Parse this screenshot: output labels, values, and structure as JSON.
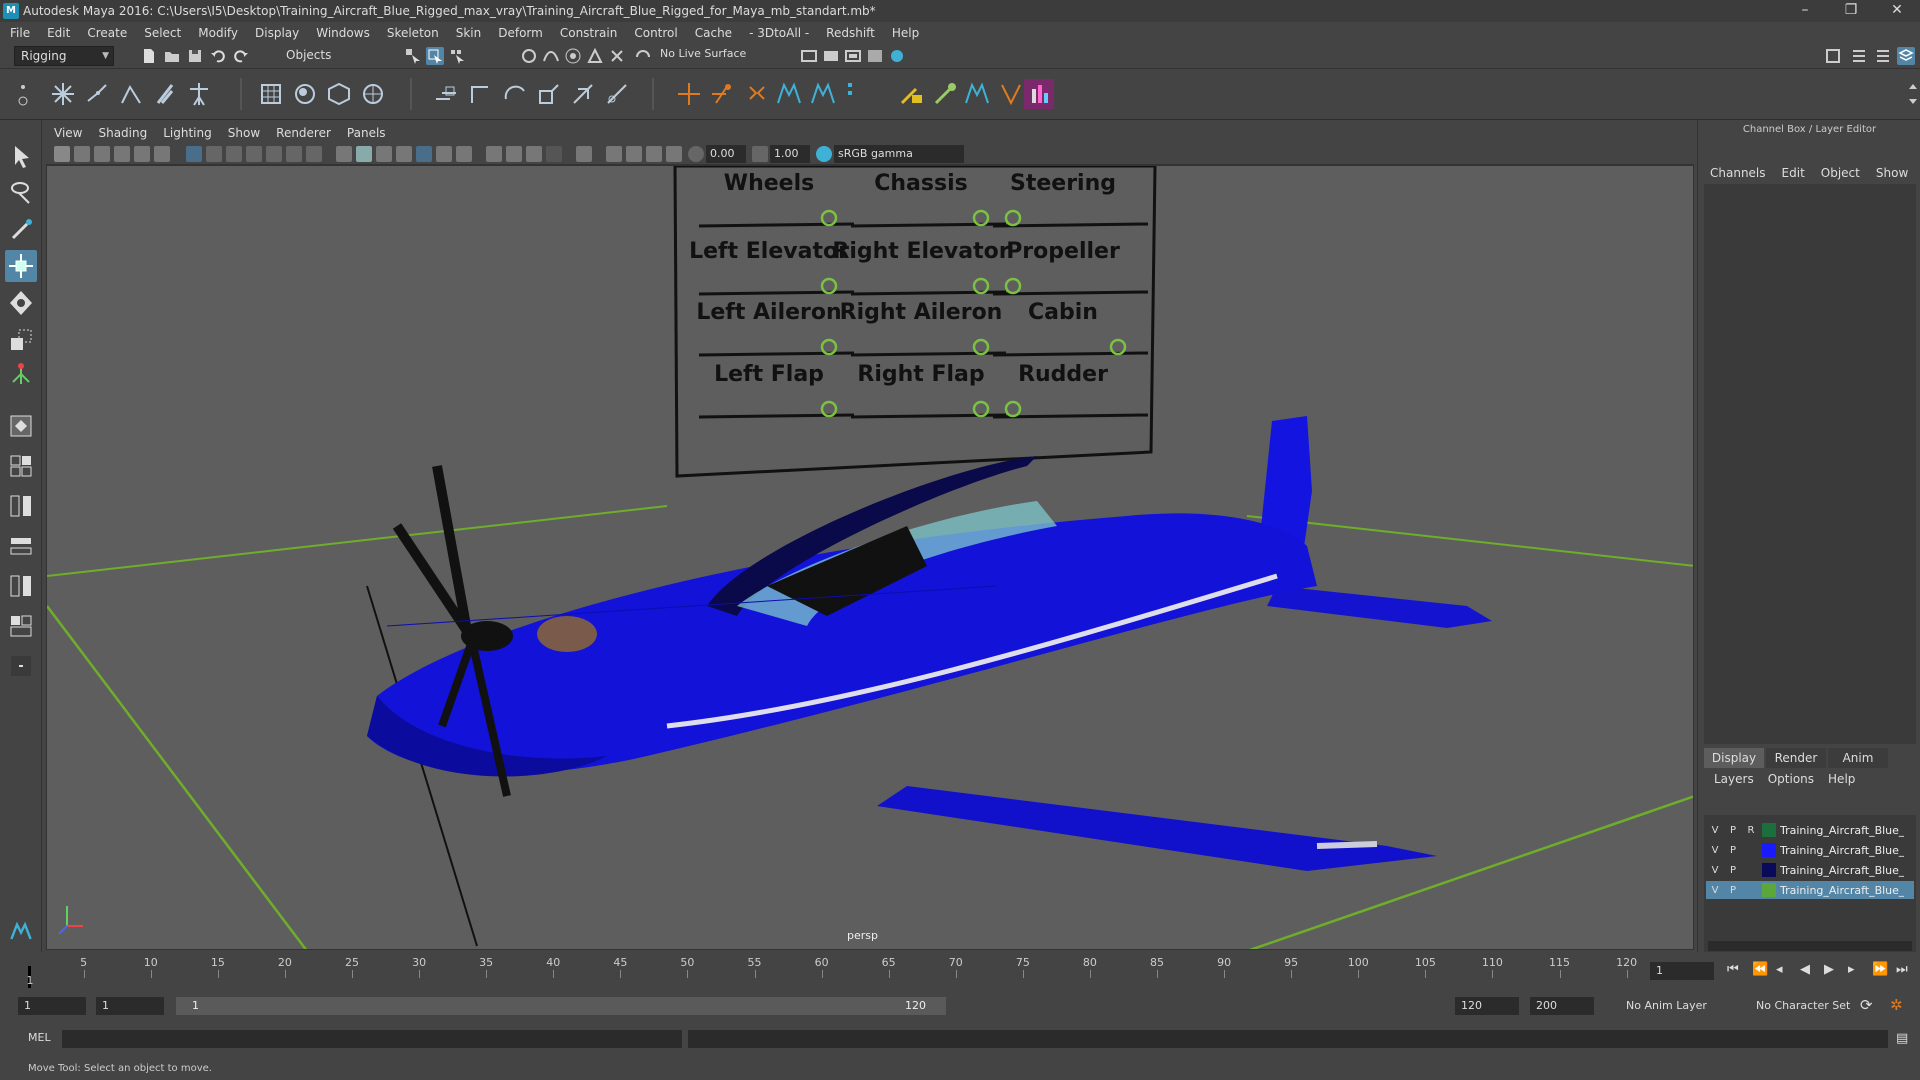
{
  "window": {
    "app_icon": "M",
    "title": "Autodesk Maya 2016: C:\\Users\\I5\\Desktop\\Training_Aircraft_Blue_Rigged_max_vray\\Training_Aircraft_Blue_Rigged_for_Maya_mb_standart.mb*",
    "controls": [
      "–",
      "❐",
      "✕"
    ]
  },
  "menubar": [
    "File",
    "Edit",
    "Create",
    "Select",
    "Modify",
    "Display",
    "Windows",
    "Skeleton",
    "Skin",
    "Deform",
    "Constrain",
    "Control",
    "Cache",
    "- 3DtoAll -",
    "Redshift",
    "Help"
  ],
  "status_line": {
    "menu_set": "Rigging",
    "selection_mode": "Objects",
    "live_surface": "No Live Surface"
  },
  "viewport": {
    "menu": [
      "View",
      "Shading",
      "Lighting",
      "Show",
      "Renderer",
      "Panels"
    ],
    "exposure": "0.00",
    "gamma": "1.00",
    "color_space": "sRGB gamma",
    "camera": "persp",
    "control_board": {
      "labels": [
        "Wheels",
        "Chassis",
        "Steering",
        "Left Elevator",
        "Right Elevator",
        "Propeller",
        "Left Aileron",
        "Right Aileron",
        "Cabin",
        "Left Flap",
        "Right Flap",
        "Rudder"
      ]
    }
  },
  "right_panel": {
    "title": "Channel Box / Layer Editor",
    "menu": [
      "Channels",
      "Edit",
      "Object",
      "Show"
    ],
    "tabs": [
      "Display",
      "Render",
      "Anim"
    ],
    "layer_menu": [
      "Layers",
      "Options",
      "Help"
    ],
    "layers": [
      {
        "v": "V",
        "p": "P",
        "r": "R",
        "color": "#1c6e3c",
        "name": "Training_Aircraft_Blue_"
      },
      {
        "v": "V",
        "p": "P",
        "r": "",
        "color": "#1a1aff",
        "name": "Training_Aircraft_Blue_"
      },
      {
        "v": "V",
        "p": "P",
        "r": "",
        "color": "#0a0a5a",
        "name": "Training_Aircraft_Blue_"
      },
      {
        "v": "V",
        "p": "P",
        "r": "",
        "color": "#5aa83a",
        "name": "Training_Aircraft_Blue_"
      }
    ]
  },
  "timeline": {
    "ticks": [
      "5",
      "10",
      "15",
      "20",
      "25",
      "30",
      "35",
      "40",
      "45",
      "50",
      "55",
      "60",
      "65",
      "70",
      "75",
      "80",
      "85",
      "90",
      "95",
      "100",
      "105",
      "110",
      "115",
      "120"
    ],
    "current_frame": "1",
    "current_frame_field": "1"
  },
  "range": {
    "start": "1",
    "start_inner": "1",
    "slider_start": "1",
    "slider_end": "120",
    "end_inner": "120",
    "end": "200",
    "anim_layer": "No Anim Layer",
    "character_set": "No Character Set"
  },
  "cmdline": {
    "label": "MEL"
  },
  "helpline": "Move Tool: Select an object to move.",
  "colors": {
    "accent": "#5285a6",
    "plane_blue": "#1212d8",
    "grid_green": "#6fae2a"
  }
}
